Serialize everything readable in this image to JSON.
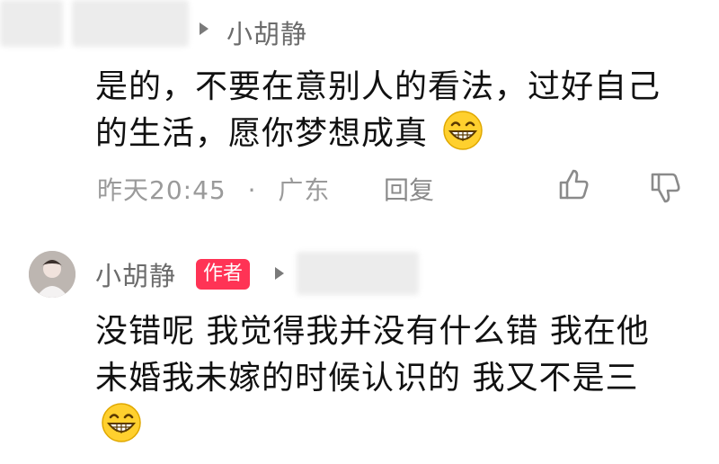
{
  "comment_top": {
    "reply_to_name": "小胡静",
    "text_line1": "是的，不要在意别人的看法，过好自己",
    "text_line2": "的生活，愿你梦想成真",
    "time": "昨天20:45",
    "dot": "·",
    "location": "广东",
    "reply_label": "回复",
    "like_icon": "thumbs-up-icon",
    "dislike_icon": "thumbs-down-icon"
  },
  "comment_author": {
    "name": "小胡静",
    "badge": "作者",
    "text_line1": "没错呢 我觉得我并没有什么错 我在他",
    "text_line2": "未婚我未嫁的时候认识的 我又不是三",
    "emoji": "grin-emoji"
  },
  "colors": {
    "badge_bg": "#ff3355",
    "meta_text": "#9a9a9a",
    "emoji_face": "#ffd02e"
  }
}
